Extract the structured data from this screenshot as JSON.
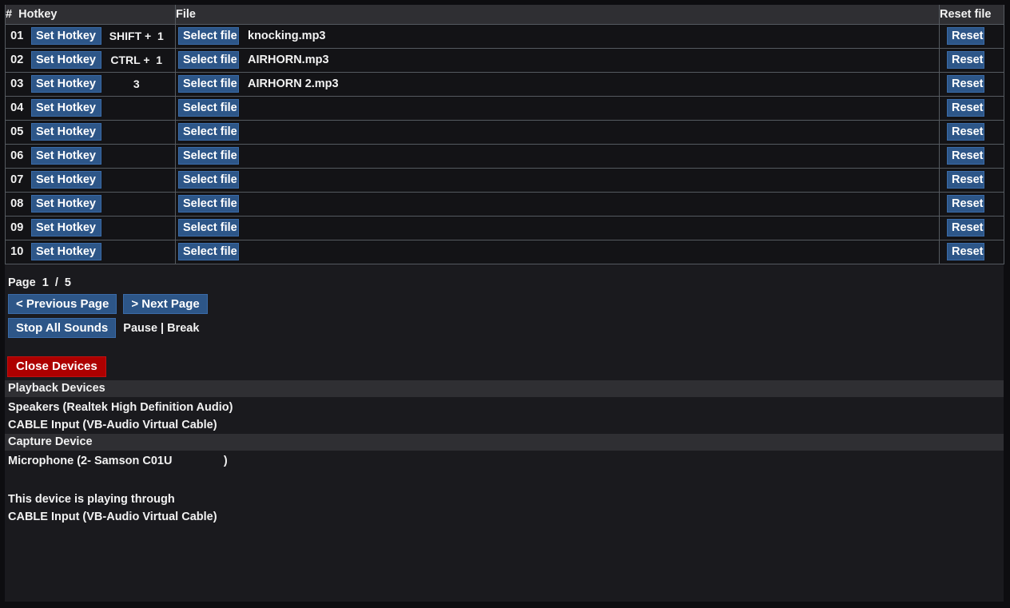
{
  "table": {
    "headers": {
      "num": "#",
      "hotkey": "Hotkey",
      "file": "File",
      "reset": "Reset file"
    },
    "buttons": {
      "set_hotkey": "Set Hotkey",
      "select_file": "Select file",
      "reset": "Reset"
    },
    "rows": [
      {
        "num": "01",
        "hotkey": "SHIFT +  1",
        "file": "knocking.mp3"
      },
      {
        "num": "02",
        "hotkey": "CTRL +  1",
        "file": "AIRHORN.mp3"
      },
      {
        "num": "03",
        "hotkey": "3",
        "file": "AIRHORN 2.mp3"
      },
      {
        "num": "04",
        "hotkey": "",
        "file": ""
      },
      {
        "num": "05",
        "hotkey": "",
        "file": ""
      },
      {
        "num": "06",
        "hotkey": "",
        "file": ""
      },
      {
        "num": "07",
        "hotkey": "",
        "file": ""
      },
      {
        "num": "08",
        "hotkey": "",
        "file": ""
      },
      {
        "num": "09",
        "hotkey": "",
        "file": ""
      },
      {
        "num": "10",
        "hotkey": "",
        "file": ""
      }
    ]
  },
  "pagination": {
    "label": "Page  1  /  5",
    "current_page": "1",
    "total_pages": "5",
    "previous_label": "< Previous Page",
    "next_label": "> Next Page"
  },
  "controls": {
    "stop_all_sounds": "Stop All Sounds",
    "stop_all_hotkey": "Pause | Break",
    "close_devices": "Close Devices"
  },
  "devices": {
    "playback_header": "Playback Devices",
    "playback_items": [
      "Speakers (Realtek High Definition Audio)",
      "CABLE Input (VB-Audio Virtual Cable)"
    ],
    "capture_header": "Capture Device",
    "capture_items": [
      "Microphone (2- Samson C01U                )"
    ],
    "playing_through_label": "This device is playing through",
    "playing_through_device": "CABLE Input (VB-Audio Virtual Cable)"
  },
  "colors": {
    "accent_blue": "#2d5688",
    "danger_red": "#ad0000",
    "window_bg": "#1a1a1e",
    "header_bar": "#2f2f33",
    "cell_bg": "#131316",
    "border": "#555a60"
  }
}
